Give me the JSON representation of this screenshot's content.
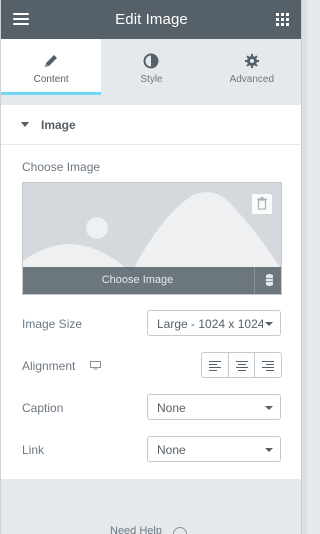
{
  "header": {
    "title": "Edit Image",
    "menu_icon": "hamburger-icon",
    "apps_icon": "grid-icon"
  },
  "tabs": [
    {
      "label": "Content",
      "icon": "pencil-icon",
      "active": true
    },
    {
      "label": "Style",
      "icon": "half-circle-icon",
      "active": false
    },
    {
      "label": "Advanced",
      "icon": "gear-icon",
      "active": false
    }
  ],
  "section": {
    "title": "Image"
  },
  "image": {
    "label": "Choose Image",
    "button_label": "Choose Image"
  },
  "image_size": {
    "label": "Image Size",
    "value": "Large - 1024 x 1024"
  },
  "alignment": {
    "label": "Alignment",
    "options": [
      "left",
      "center",
      "right"
    ]
  },
  "caption": {
    "label": "Caption",
    "value": "None"
  },
  "link": {
    "label": "Link",
    "value": "None"
  },
  "footer": {
    "help_text": "Need Help"
  },
  "colors": {
    "header": "#556068",
    "accent": "#71d7f7",
    "panel": "#ffffff",
    "background": "#e6e9ec"
  }
}
